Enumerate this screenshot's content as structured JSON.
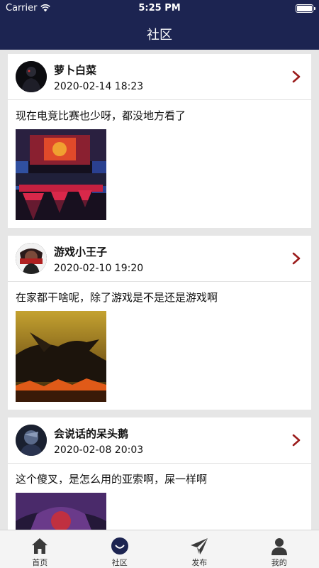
{
  "status_bar": {
    "carrier": "Carrier",
    "time": "5:25 PM"
  },
  "header": {
    "title": "社区"
  },
  "posts": [
    {
      "username": "萝卜白菜",
      "time": "2020-02-14 18:23",
      "content": "现在电竞比赛也少呀，都没地方看了"
    },
    {
      "username": "游戏小王子",
      "time": "2020-02-10 19:20",
      "content": "在家都干啥呢，除了游戏是不是还是游戏啊"
    },
    {
      "username": "会说话的呆头鹅",
      "time": "2020-02-08 20:03",
      "content": "这个傻叉，是怎么用的亚索啊，屎一样啊"
    }
  ],
  "tabs": [
    {
      "label": "首页",
      "icon": "home-icon"
    },
    {
      "label": "社区",
      "icon": "community-icon",
      "active": true
    },
    {
      "label": "发布",
      "icon": "send-icon"
    },
    {
      "label": "我的",
      "icon": "user-icon"
    }
  ],
  "colors": {
    "header_bg": "#1c2451",
    "chevron": "#9b1c1c",
    "tab_icon": "#3a3a3a"
  }
}
